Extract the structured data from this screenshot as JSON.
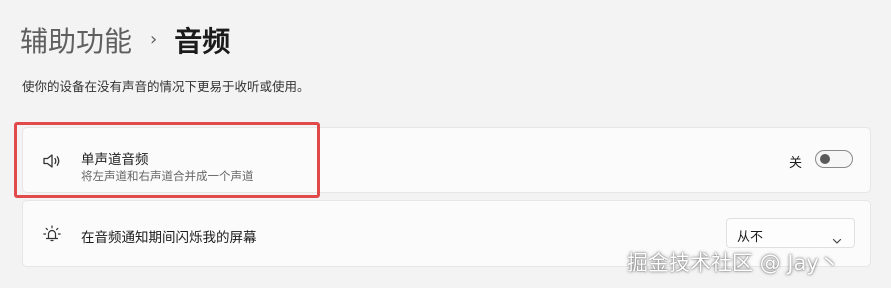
{
  "breadcrumb": {
    "parent": "辅助功能",
    "separator": "›",
    "current": "音频"
  },
  "description": "使你的设备在没有声音的情况下更易于收听或使用。",
  "settings": [
    {
      "icon": "speaker-icon",
      "title": "单声道音频",
      "subtitle": "将左声道和右声道合并成一个声道",
      "control": "toggle",
      "state_label": "关",
      "on": false
    },
    {
      "icon": "flash-alert-icon",
      "title": "在音频通知期间闪烁我的屏幕",
      "control": "select",
      "selected": "从不"
    }
  ],
  "highlight_color": "#e04a4a",
  "watermark": "掘金技术社区 @ Jay丶"
}
